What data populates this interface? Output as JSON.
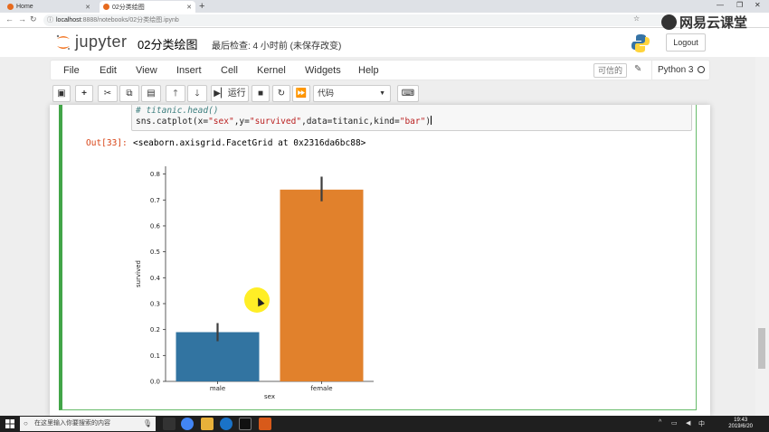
{
  "browser": {
    "tabs": [
      {
        "label": "Home",
        "active": false
      },
      {
        "label": "02分类绘图",
        "active": true
      }
    ],
    "url_host": "localhost",
    "url_path": ":8888/notebooks/02分类绘图.ipynb",
    "watermark": "网易云课堂"
  },
  "header": {
    "app_name": "jupyter",
    "notebook_title": "02分类绘图",
    "checkpoint": "最后检查: 4 小时前  (未保存改变)",
    "logout_label": "Logout"
  },
  "menubar": {
    "items": [
      "File",
      "Edit",
      "View",
      "Insert",
      "Cell",
      "Kernel",
      "Widgets",
      "Help"
    ],
    "trusted_label": "可信的",
    "kernel_name": "Python 3"
  },
  "toolbar": {
    "run_label": "运行",
    "cell_type": "代码"
  },
  "cell": {
    "code_comment": "# titanic.head()",
    "code_prefix": "sns.catplot(x=",
    "code_x": "\"sex\"",
    "code_mid1": ",y=",
    "code_y": "\"survived\"",
    "code_mid2": ",data=titanic,kind=",
    "code_kind": "\"bar\"",
    "code_suffix": ")",
    "out_prompt": "Out[33]:",
    "out_text": "<seaborn.axisgrid.FacetGrid at 0x2316da6bc88>"
  },
  "chart_data": {
    "type": "bar",
    "categories": [
      "male",
      "female"
    ],
    "values": [
      0.19,
      0.74
    ],
    "error_low": [
      0.155,
      0.695
    ],
    "error_high": [
      0.225,
      0.79
    ],
    "colors": [
      "#3274a1",
      "#e1812c"
    ],
    "xlabel": "sex",
    "ylabel": "survived",
    "ylim": [
      0,
      0.83
    ],
    "yticks": [
      0.0,
      0.1,
      0.2,
      0.3,
      0.4,
      0.5,
      0.6,
      0.7,
      0.8
    ],
    "ytick_labels": [
      "0.0",
      "0.1",
      "0.2",
      "0.3",
      "0.4",
      "0.5",
      "0.6",
      "0.7",
      "0.8"
    ]
  },
  "taskbar": {
    "search_placeholder": "在这里输入你要搜索的内容",
    "time": "19:43",
    "date": "2019/6/20"
  }
}
